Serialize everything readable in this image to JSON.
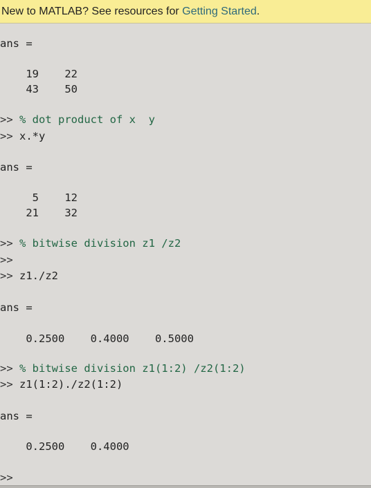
{
  "banner": {
    "prefix": "New to MATLAB? See resources for ",
    "link": "Getting Started",
    "suffix": "."
  },
  "console": {
    "ans_label_1": "ans =",
    "matrix_1": {
      "row1": "    19    22",
      "row2": "    43    50"
    },
    "cmd_1": {
      "prompt": ">> ",
      "text": "% dot product of x  y"
    },
    "cmd_2": {
      "prompt": ">> ",
      "text": "x.*y"
    },
    "ans_label_2": "ans =",
    "matrix_2": {
      "row1": "     5    12",
      "row2": "    21    32"
    },
    "cmd_3": {
      "prompt": ">> ",
      "text": "% bitwise division z1 /z2"
    },
    "cmd_4": {
      "prompt": ">>",
      "text": ""
    },
    "cmd_5": {
      "prompt": ">> ",
      "text": "z1./z2"
    },
    "ans_label_3": "ans =",
    "vector_3": "    0.2500    0.4000    0.5000",
    "cmd_6": {
      "prompt": ">> ",
      "text": "% bitwise division z1(1:2) /z2(1:2)"
    },
    "cmd_7": {
      "prompt": ">> ",
      "text": "z1(1:2)./z2(1:2)"
    },
    "ans_label_4": "ans =",
    "vector_4": "    0.2500    0.4000",
    "final_prompt": ">>"
  },
  "colors": {
    "banner_bg": "#f9ed95",
    "link": "#2f6a7a",
    "console_bg": "#dcdad7",
    "comment": "#226644"
  }
}
